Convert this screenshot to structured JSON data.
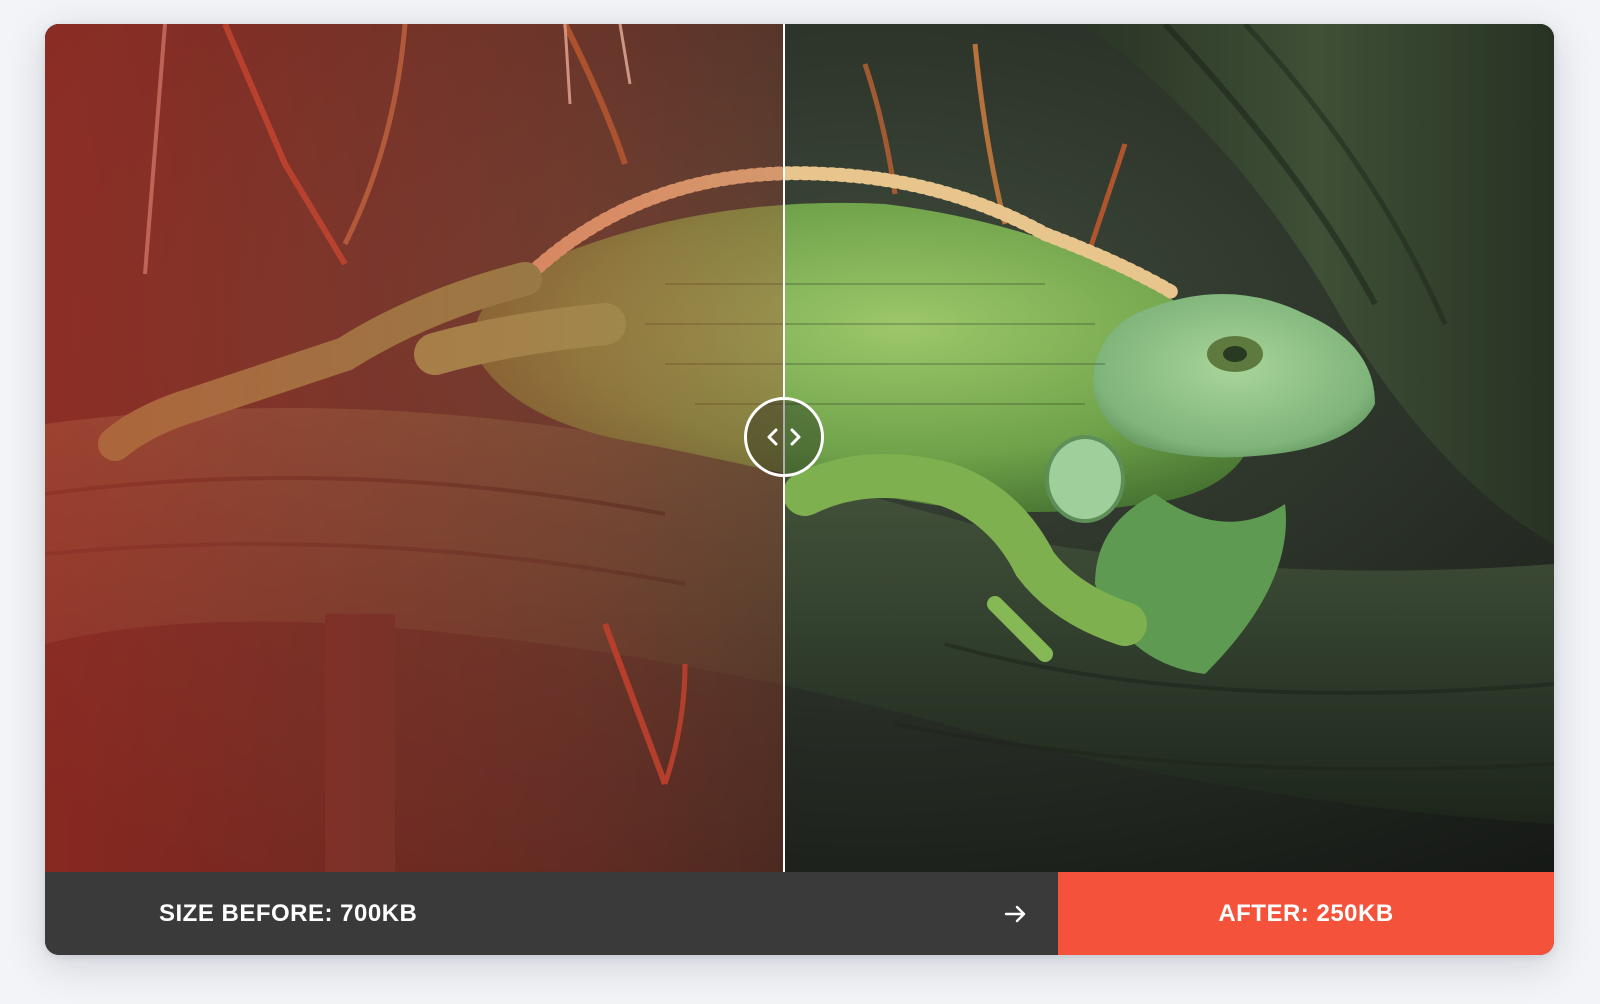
{
  "comparison": {
    "before_label": "SIZE BEFORE: 700KB",
    "after_label": "AFTER: 250KB",
    "split_fraction": 0.49
  },
  "icons": {
    "handle": "chevrons-left-right-icon",
    "arrow": "arrow-right-icon"
  },
  "colors": {
    "before_bar": "#3b3a3a",
    "after_bar": "#f4523b",
    "divider": "#ffffff",
    "page_background": "#f3f4f7"
  }
}
